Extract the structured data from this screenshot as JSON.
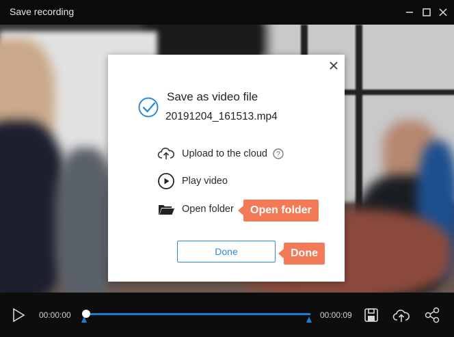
{
  "window": {
    "title": "Save recording",
    "controls": [
      "minimize-icon",
      "maximize-icon",
      "close-icon"
    ]
  },
  "dialog": {
    "title": "Save as video file",
    "filename": "20191204_161513.mp4",
    "options": [
      {
        "label": "Upload to the cloud",
        "icon": "cloud-upload-icon"
      },
      {
        "label": "Play video",
        "icon": "play-circle-icon"
      },
      {
        "label": "Open folder",
        "icon": "folder-icon"
      }
    ],
    "done_label": "Done"
  },
  "callouts": {
    "open_folder": "Open folder",
    "done": "Done"
  },
  "player": {
    "time_current": "00:00:00",
    "time_total": "00:00:09",
    "progress": 0
  },
  "colors": {
    "accent": "#2a8ad8",
    "callout": "#f47a57",
    "track": "#1b7fd6"
  }
}
